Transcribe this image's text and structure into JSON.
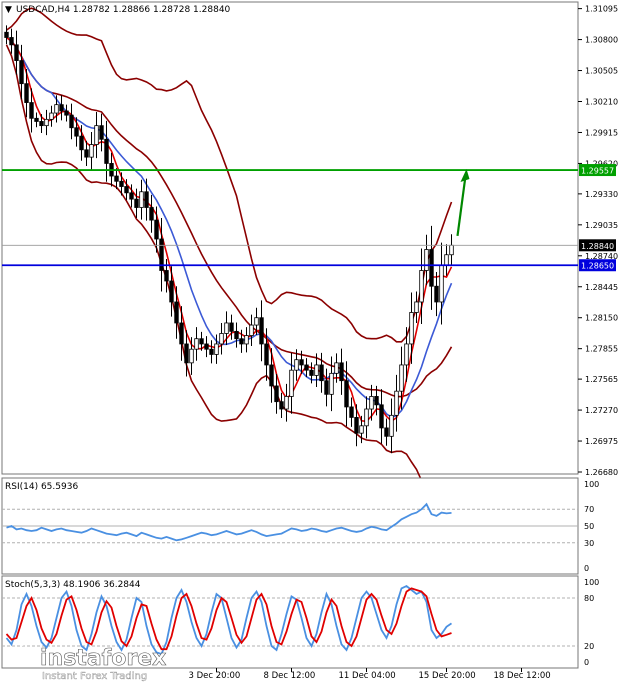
{
  "colors": {
    "background": "#ffffff",
    "grid": "#c8c8c8",
    "candle": "#000000",
    "bollinger": "#8b0000",
    "ma_red": "#e00000",
    "ma_blue": "#3c5ad6",
    "resistance": "#00a000",
    "support": "#0000dd",
    "arrow": "#008800",
    "rsi": "#4a90e2",
    "stoch_main": "#4a90e2",
    "stoch_signal": "#e00000"
  },
  "chart_data": {
    "type": "candlestick",
    "header": "USDCAD,H4  1.28782 1.28866 1.28728 1.28840",
    "symbol": "USDCAD,H4",
    "ohlc_text": "1.28782 1.28866 1.28728 1.28840",
    "y_ticks": [
      "1.31095",
      "1.30800",
      "1.30505",
      "1.30210",
      "1.29915",
      "1.29620",
      "1.29330",
      "1.29035",
      "1.28740",
      "1.28445",
      "1.28150",
      "1.27855",
      "1.27565",
      "1.27270",
      "1.26975",
      "1.26680"
    ],
    "ylim": [
      1.2668,
      1.3112
    ],
    "x_ticks": [
      {
        "label": "3 Dec 20:00",
        "bar": 42
      },
      {
        "label": "8 Dec 12:00",
        "bar": 57
      },
      {
        "label": "11 Dec 04:00",
        "bar": 72
      },
      {
        "label": "15 Dec 20:00",
        "bar": 88
      },
      {
        "label": "18 Dec 12:00",
        "bar": 103
      }
    ],
    "price_labels": [
      {
        "text": "1.29557",
        "value": 1.29557,
        "kind": "resistance"
      },
      {
        "text": "1.28840",
        "value": 1.2884,
        "kind": "current"
      },
      {
        "text": "1.28650",
        "value": 1.2865,
        "kind": "support"
      }
    ],
    "closes": [
      1.3082,
      1.3075,
      1.306,
      1.3038,
      1.302,
      1.3005,
      1.3002,
      1.2998,
      1.3004,
      1.301,
      1.3018,
      1.3012,
      1.3008,
      1.2996,
      1.2988,
      1.2975,
      1.2968,
      1.298,
      1.2998,
      1.2985,
      1.2962,
      1.295,
      1.2945,
      1.294,
      1.2934,
      1.2928,
      1.292,
      1.2935,
      1.292,
      1.2908,
      1.289,
      1.286,
      1.285,
      1.283,
      1.281,
      1.279,
      1.2772,
      1.2785,
      1.2795,
      1.279,
      1.2785,
      1.278,
      1.279,
      1.28,
      1.281,
      1.2802,
      1.2795,
      1.279,
      1.2798,
      1.2808,
      1.2815,
      1.279,
      1.277,
      1.275,
      1.2735,
      1.2728,
      1.274,
      1.2765,
      1.2775,
      1.277,
      1.2765,
      1.276,
      1.277,
      1.2755,
      1.2742,
      1.2762,
      1.2772,
      1.2755,
      1.273,
      1.272,
      1.2705,
      1.2712,
      1.2728,
      1.274,
      1.2732,
      1.271,
      1.2702,
      1.2722,
      1.2745,
      1.277,
      1.279,
      1.282,
      1.283,
      1.286,
      1.288,
      1.2845,
      1.283,
      1.2865,
      1.2875,
      1.2884
    ],
    "rsi": {
      "label": "RSI(14) 65.5936",
      "ticks": [
        "100",
        "70",
        "50",
        "30",
        "0"
      ],
      "levels": [
        70,
        50,
        30
      ],
      "values": [
        48,
        50,
        46,
        47,
        45,
        44,
        45,
        48,
        46,
        44,
        46,
        47,
        45,
        44,
        43,
        42,
        44,
        47,
        45,
        43,
        41,
        40,
        39,
        41,
        42,
        40,
        38,
        42,
        40,
        38,
        36,
        35,
        37,
        35,
        33,
        34,
        36,
        38,
        40,
        42,
        41,
        39,
        40,
        42,
        44,
        42,
        40,
        41,
        43,
        45,
        43,
        40,
        38,
        39,
        40,
        41,
        44,
        47,
        46,
        44,
        45,
        47,
        46,
        44,
        43,
        45,
        47,
        48,
        46,
        44,
        43,
        44,
        47,
        49,
        48,
        46,
        45,
        49,
        53,
        58,
        61,
        64,
        66,
        70,
        76,
        64,
        62,
        66,
        65,
        65.59
      ]
    },
    "stochastic": {
      "label": "Stoch(5,3,3) 48.1906 36.2844",
      "ticks": [
        "100",
        "80",
        "20",
        "0"
      ],
      "levels": [
        80,
        20
      ],
      "main": [
        30,
        22,
        40,
        72,
        85,
        70,
        45,
        25,
        18,
        30,
        55,
        80,
        88,
        70,
        40,
        20,
        15,
        35,
        62,
        82,
        70,
        45,
        25,
        15,
        28,
        55,
        80,
        75,
        45,
        22,
        12,
        10,
        25,
        55,
        80,
        90,
        75,
        50,
        30,
        20,
        35,
        62,
        85,
        80,
        55,
        30,
        18,
        28,
        55,
        80,
        88,
        75,
        45,
        20,
        15,
        35,
        60,
        82,
        78,
        55,
        30,
        20,
        35,
        62,
        85,
        72,
        45,
        22,
        15,
        30,
        55,
        80,
        88,
        80,
        60,
        40,
        30,
        45,
        72,
        92,
        95,
        90,
        85,
        88,
        75,
        40,
        30,
        35,
        44,
        48.19
      ],
      "signal": [
        35,
        28,
        30,
        50,
        70,
        80,
        65,
        42,
        28,
        24,
        35,
        58,
        78,
        82,
        65,
        42,
        25,
        22,
        38,
        62,
        76,
        68,
        45,
        26,
        20,
        32,
        55,
        72,
        70,
        48,
        28,
        16,
        16,
        32,
        58,
        80,
        85,
        70,
        48,
        30,
        28,
        42,
        65,
        80,
        75,
        55,
        34,
        24,
        32,
        55,
        78,
        85,
        72,
        45,
        25,
        22,
        38,
        60,
        78,
        75,
        55,
        32,
        25,
        38,
        62,
        78,
        70,
        45,
        25,
        20,
        32,
        55,
        78,
        85,
        78,
        58,
        40,
        35,
        48,
        70,
        88,
        92,
        90,
        88,
        82,
        60,
        40,
        32,
        34,
        36.28
      ]
    },
    "annotation": "up-arrow"
  },
  "logo": {
    "name": "instaforex",
    "tagline": "Instant Forex Trading"
  }
}
